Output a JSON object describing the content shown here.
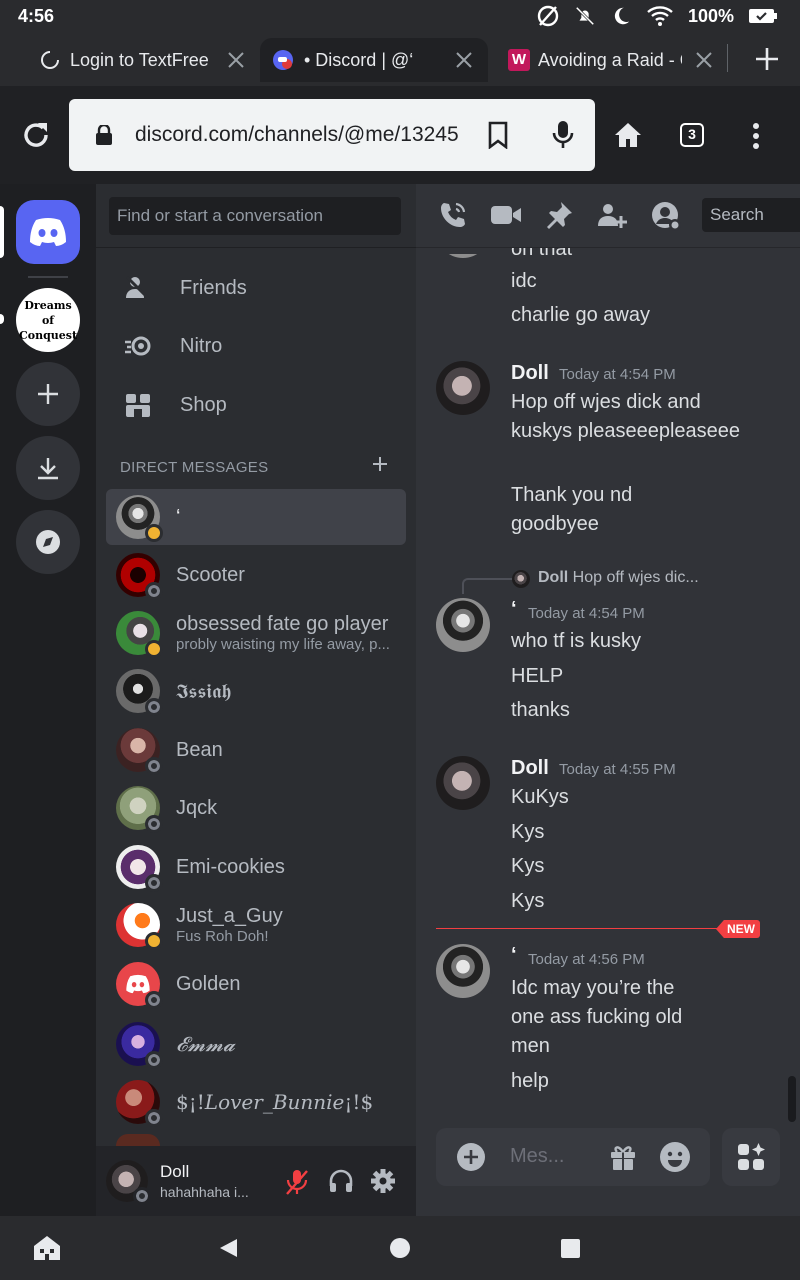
{
  "status_bar": {
    "time": "4:56",
    "battery": "100%"
  },
  "browser": {
    "tabs": [
      {
        "title": "Login to TextFree |"
      },
      {
        "title": "• Discord | @‘"
      },
      {
        "title": "Avoiding a Raid - Co",
        "badge": "W"
      }
    ],
    "url": "discord.com/channels/@me/13245",
    "tab_count": "3"
  },
  "servers": [
    {
      "name": "Dreams of Conquest",
      "label": "Dreams of Conquest"
    }
  ],
  "dm_panel": {
    "search_placeholder": "Find or start a conversation",
    "nav": [
      {
        "label": "Friends"
      },
      {
        "label": "Nitro"
      },
      {
        "label": "Shop"
      }
    ],
    "header": "DIRECT MESSAGES",
    "dms": [
      {
        "name": "‘",
        "status": "idle"
      },
      {
        "name": "Scooter",
        "status": "offline"
      },
      {
        "name": "obsessed fate go player",
        "sub": "probly waisting my life away, p...",
        "status": "idle"
      },
      {
        "name": "𝕴𝖘𝖘𝖎𝖆𝖍",
        "status": "offline"
      },
      {
        "name": "Bean",
        "status": "offline"
      },
      {
        "name": "Jqck",
        "status": "offline"
      },
      {
        "name": "Emi-cookies",
        "status": "offline"
      },
      {
        "name": "Just_a_Guy",
        "sub": "Fus Roh Doh!",
        "status": "idle"
      },
      {
        "name": "Golden",
        "status": "offline"
      },
      {
        "name": "𝓔𝓶𝓶𝓪",
        "status": "offline"
      },
      {
        "name": "$¡!𝐿𝑜𝑣𝑒𝑟_𝐵𝑢𝑛𝑛𝑖𝑒¡!$",
        "status": "offline"
      }
    ]
  },
  "user_panel": {
    "name": "Doll",
    "status": "hahahhaha i..."
  },
  "chat": {
    "search": "Search",
    "top_partial": "on that",
    "lines_pre": [
      "idc",
      "charlie go away"
    ],
    "groups": [
      {
        "author": "Doll",
        "time": "Today at 4:54 PM",
        "lines": [
          "Hop off wjes dick and kuskys pleaseeepleaseee",
          "Thank you nd goodbyee"
        ]
      },
      {
        "reply_author": "Doll",
        "reply_text": "Hop off wjes dic...",
        "author": "‘",
        "time": "Today at 4:54 PM",
        "lines": [
          "who tf is kusky",
          "HELP",
          "thanks"
        ]
      },
      {
        "author": "Doll",
        "time": "Today at 4:55 PM",
        "lines": [
          "KuKys",
          "Kys",
          "Kys",
          "Kys"
        ]
      },
      {
        "author": "‘",
        "time": "Today at 4:56 PM",
        "lines": [
          "Idc may you’re the one ass fucking old men",
          "help"
        ]
      }
    ],
    "new_badge": "NEW",
    "composer_placeholder": "Mes..."
  },
  "colors": {
    "blurple": "#5865f2",
    "new_red": "#f23f42",
    "idle": "#f0b232"
  }
}
